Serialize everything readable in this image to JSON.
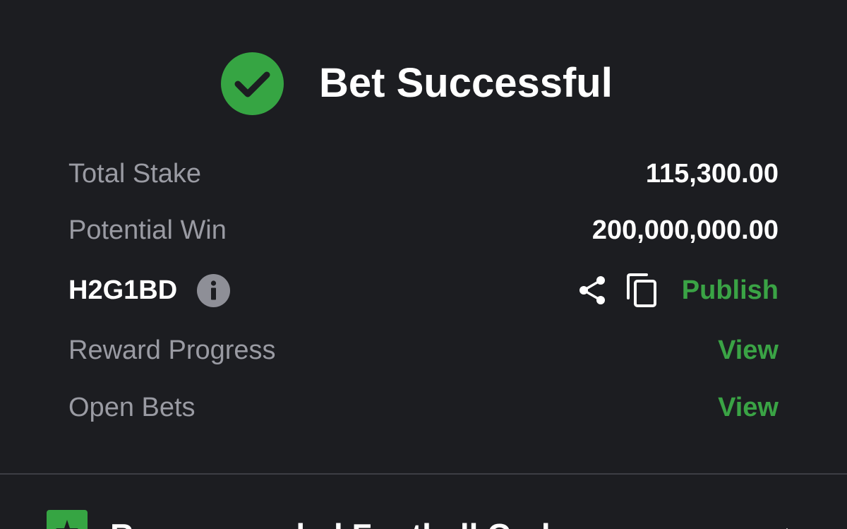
{
  "header": {
    "title": "Bet Successful",
    "icon": "check-circle-icon",
    "icon_color": "#36a543"
  },
  "summary": {
    "total_stake_label": "Total Stake",
    "total_stake_value": "115,300.00",
    "potential_win_label": "Potential Win",
    "potential_win_value": "200,000,000.00",
    "booking_code": "H2G1BD",
    "booking_code_icon": "info-icon",
    "share_icon": "share-icon",
    "copy_icon": "copy-icon",
    "publish_label": "Publish",
    "reward_progress_label": "Reward Progress",
    "reward_progress_link": "View",
    "open_bets_label": "Open Bets",
    "open_bets_link": "View"
  },
  "recommended": {
    "title": "Recommended Football Codes",
    "icon": "star-icon"
  },
  "colors": {
    "background": "#1c1d21",
    "accent_green": "#3aa345",
    "muted_text": "#9a9ba3",
    "divider": "#3d3e44"
  }
}
